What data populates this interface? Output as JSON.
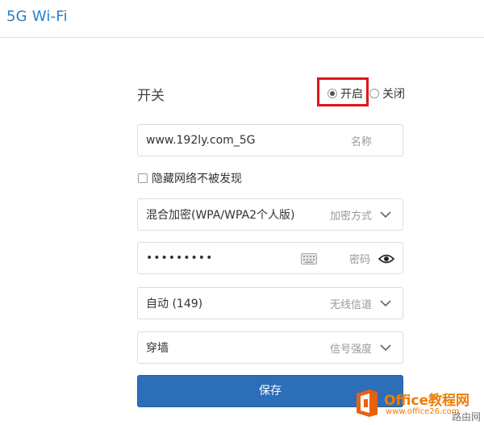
{
  "section": {
    "title": "5G Wi-Fi"
  },
  "switch": {
    "label": "开关",
    "on_label": "开启",
    "off_label": "关闭",
    "selected": "开启",
    "highlight_color": "#e0151b"
  },
  "ssid": {
    "value": "www.192ly.com_5G",
    "hint": "名称"
  },
  "hide_network": {
    "label": "隐藏网络不被发现",
    "checked": false
  },
  "encryption": {
    "value": "混合加密(WPA/WPA2个人版)",
    "hint": "加密方式",
    "icon": "chevron-down-icon"
  },
  "password": {
    "value": "•••••••••",
    "hint": "密码",
    "icons": [
      "keyboard-icon",
      "eye-icon"
    ]
  },
  "channel": {
    "value": "自动 (149)",
    "hint": "无线信道",
    "icon": "chevron-down-icon"
  },
  "tx_power": {
    "value": "穿墙",
    "hint": "信号强度",
    "icon": "chevron-down-icon"
  },
  "save": {
    "label": "保存",
    "color": "#2d6eb8"
  },
  "watermark": {
    "title": "Office教程网",
    "url": "www.office26.com",
    "corner": "路由网",
    "color": "#f07c00"
  },
  "colors": {
    "accent": "#2a7fc6"
  }
}
